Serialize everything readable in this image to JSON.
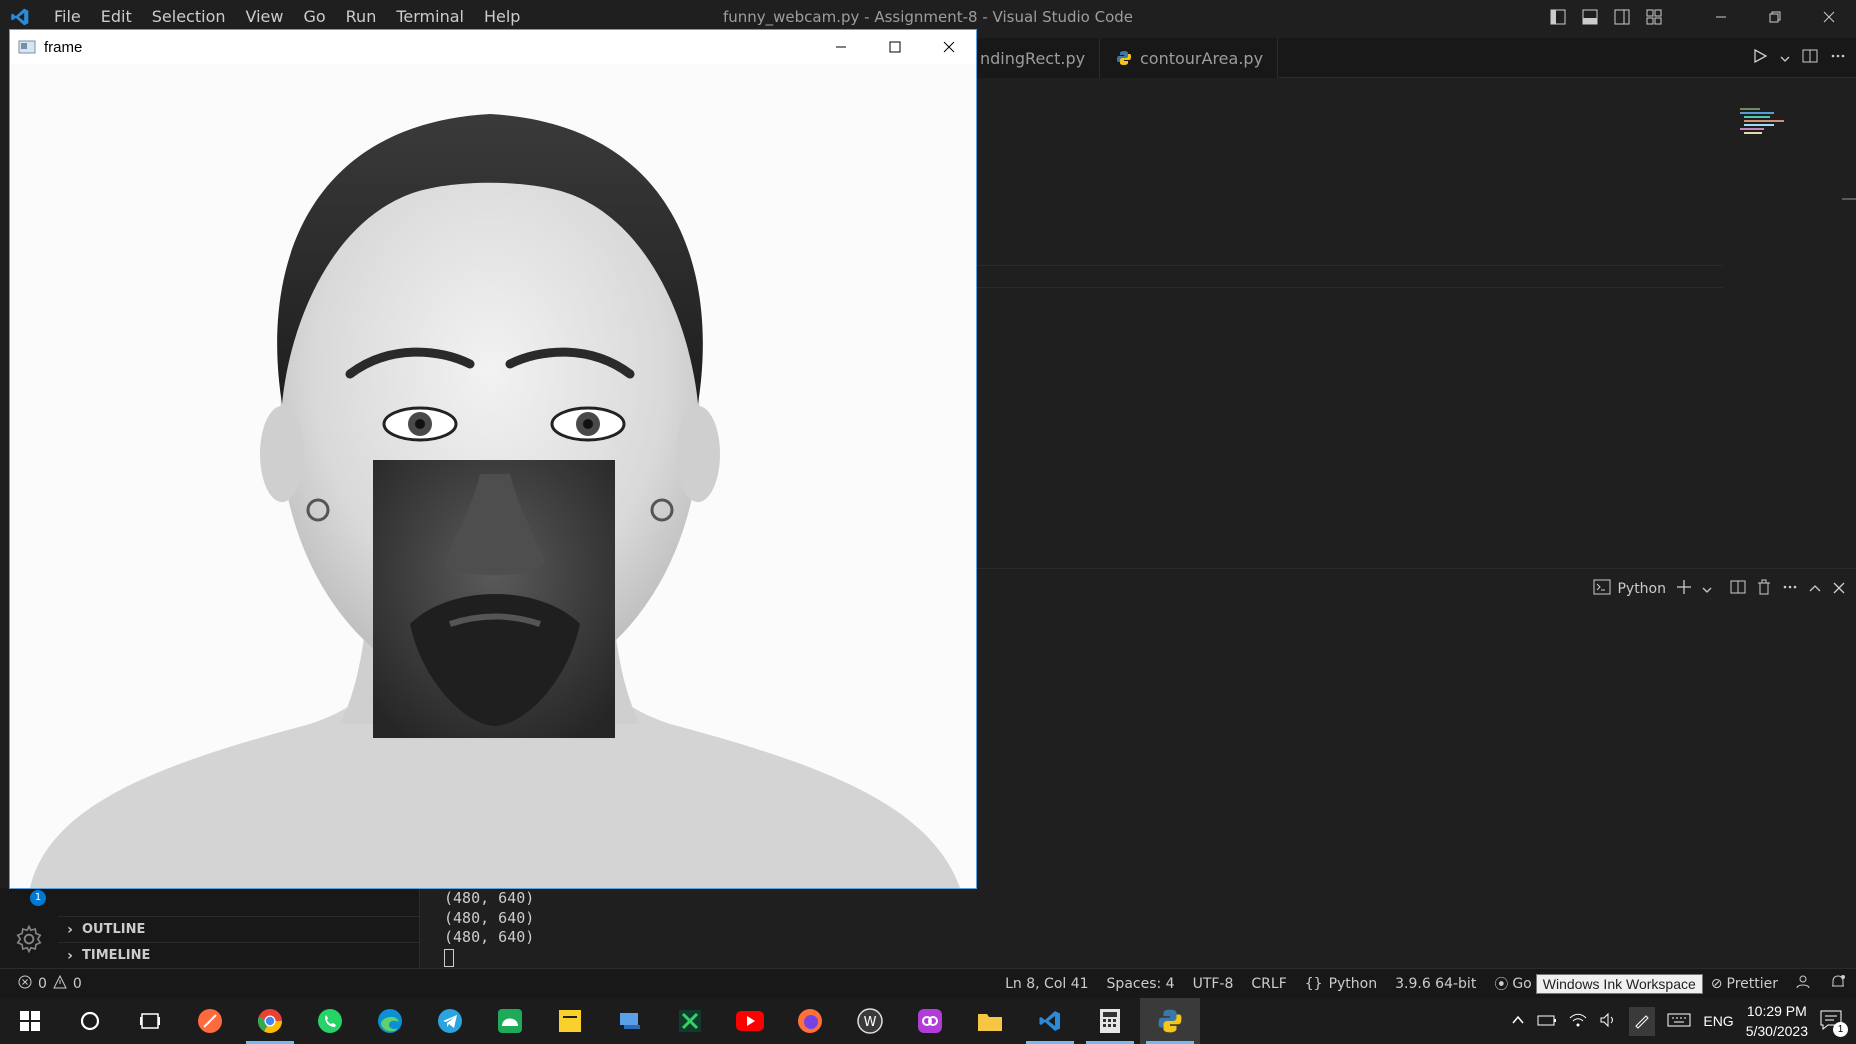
{
  "titlebar": {
    "menu": [
      "File",
      "Edit",
      "Selection",
      "View",
      "Go",
      "Run",
      "Terminal",
      "Help"
    ],
    "window_title": "funny_webcam.py - Assignment-8 - Visual Studio Code",
    "icons": [
      "vscode-logo-icon",
      "toggle-primary-sidebar-icon",
      "toggle-panel-icon",
      "toggle-secondary-sidebar-icon",
      "customize-layout-icon",
      "minimize-icon",
      "restore-icon",
      "close-icon"
    ]
  },
  "tabs": [
    {
      "label": "ndingRect.py"
    },
    {
      "label": "contourArea.py",
      "icon": "python-file-icon"
    }
  ],
  "panel": {
    "terminal_profile": "Python",
    "output_lines": [
      "(480, 640)",
      "(480, 640)",
      "(480, 640)"
    ]
  },
  "sidebar": {
    "sections": [
      "OUTLINE",
      "TIMELINE"
    ],
    "badge_count": "1"
  },
  "statusbar": {
    "errors": "0",
    "warnings": "0",
    "position": "Ln 8, Col 41",
    "spaces": "Spaces: 4",
    "encoding": "UTF-8",
    "eol": "CRLF",
    "language": "Python",
    "interpreter": "3.9.6 64-bit",
    "golive": "Go",
    "tooltip": "Windows Ink Workspace",
    "prettier": "Prettier"
  },
  "frame_window": {
    "title": "frame",
    "image_description_icon": "webcam-frame-image"
  },
  "taskbar": {
    "apps": [
      "start-icon",
      "search-icon",
      "task-view-icon",
      "brave-like-icon",
      "chrome-icon",
      "whatsapp-icon",
      "edge-icon",
      "telegram-icon",
      "nearby-share-icon",
      "sticky-notes-icon",
      "paint-icon",
      "app-green-icon",
      "youtube-icon",
      "firefox-icon",
      "wordpress-like-icon",
      "app-purple-icon",
      "file-explorer-icon",
      "vscode-icon",
      "calculator-icon",
      "python-icon"
    ],
    "language": "ENG",
    "time": "10:29 PM",
    "date": "5/30/2023",
    "notification_count": "1"
  },
  "colors": {
    "editor_bg": "#1f1f1f",
    "accent": "#0078d4",
    "frame_border": "#5ea0d9"
  }
}
